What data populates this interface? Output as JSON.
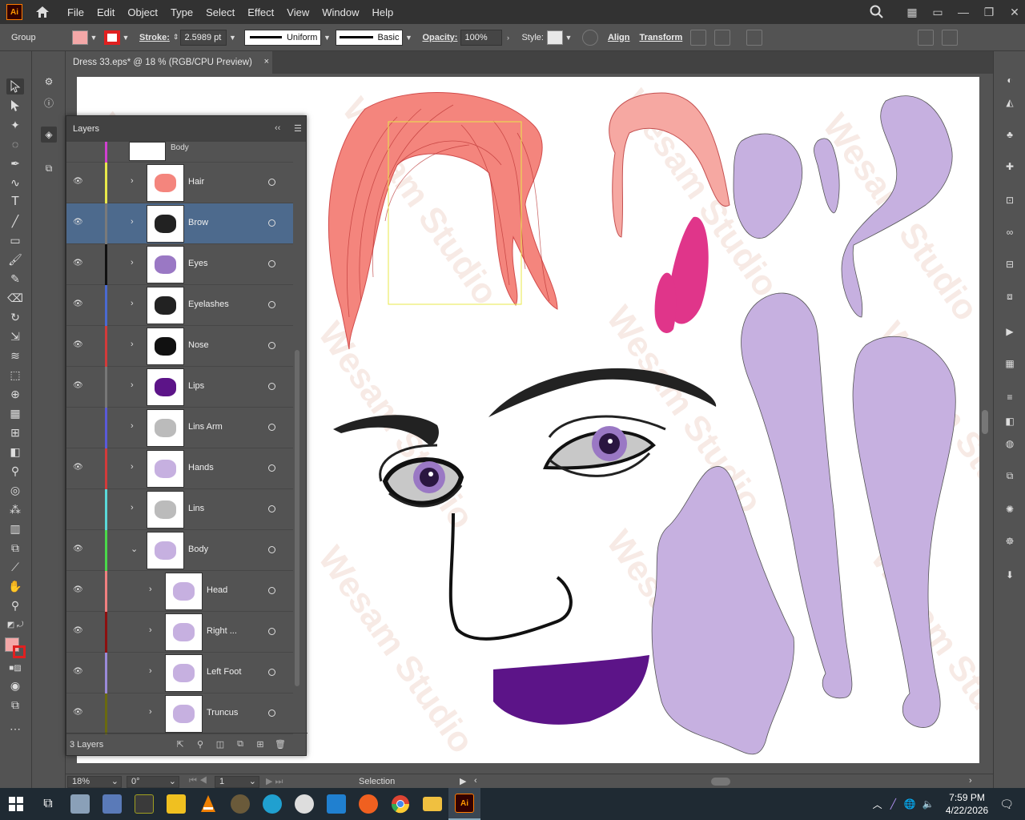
{
  "app": {
    "logo": "Ai"
  },
  "menu": [
    "File",
    "Edit",
    "Object",
    "Type",
    "Select",
    "Effect",
    "View",
    "Window",
    "Help"
  ],
  "control_bar": {
    "selection_type": "Group",
    "fill_color": "#f4a8a8",
    "stroke_color": "#e02020",
    "stroke_label": "Stroke:",
    "stroke_weight": "2.5989 pt",
    "profile_label": "Uniform",
    "brush_label": "Basic",
    "opacity_label": "Opacity:",
    "opacity_value": "100%",
    "style_label": "Style:",
    "align_label": "Align",
    "transform_label": "Transform"
  },
  "document": {
    "tab_title": "Dress 33.eps* @ 18 % (RGB/CPU Preview)",
    "close_glyph": "×"
  },
  "layers_panel": {
    "title": "Layers",
    "partial_top_label": "Body",
    "rows": [
      {
        "name": "Hair",
        "color": "#e8e84a",
        "visible": true
      },
      {
        "name": "Brow",
        "color": "#7a7a7a",
        "visible": true
      },
      {
        "name": "Eyes",
        "color": "#111111",
        "visible": true
      },
      {
        "name": "Eyelashes",
        "color": "#4a6ad0",
        "visible": true
      },
      {
        "name": "Nose",
        "color": "#d23a3a",
        "visible": true
      },
      {
        "name": "Lips",
        "color": "#777777",
        "visible": true
      },
      {
        "name": "Lins Arm",
        "color": "#5a5ad8",
        "visible": false
      },
      {
        "name": "Hands",
        "color": "#d23a3a",
        "visible": true
      },
      {
        "name": "Lins",
        "color": "#5ad8d8",
        "visible": false
      },
      {
        "name": "Body",
        "color": "#4ad84a",
        "visible": true
      },
      {
        "name": "Head",
        "color": "#f08080",
        "visible": true
      },
      {
        "name": "Right ...",
        "color": "#8b1010",
        "visible": true
      },
      {
        "name": "Left Foot",
        "color": "#9a8ad8",
        "visible": true
      },
      {
        "name": "Truncus",
        "color": "#6a6a10",
        "visible": true
      }
    ],
    "layer_count": "3 Layers"
  },
  "watermark": "Wesam Studio",
  "statusbar": {
    "zoom": "18%",
    "rotation": "0°",
    "artboard": "1",
    "tool": "Selection"
  },
  "taskbar": {
    "time": "7:59 PM",
    "date": "4/22/2026"
  }
}
